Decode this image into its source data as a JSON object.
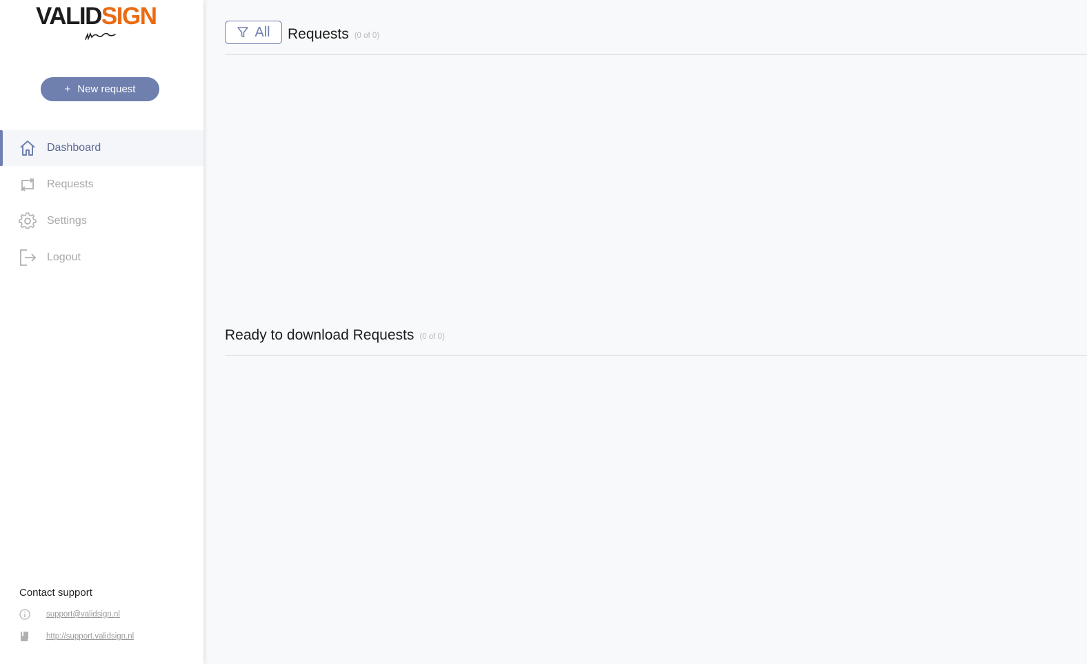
{
  "brand": {
    "logo_part1": "VALID",
    "logo_part2": "SIGN",
    "accent_color": "#6f7fae",
    "logo_orange": "#ea6a12"
  },
  "sidebar": {
    "new_request": {
      "plus": "+",
      "label": "New request"
    },
    "items": [
      {
        "label": "Dashboard",
        "icon": "home-icon",
        "active": true
      },
      {
        "label": "Requests",
        "icon": "swap-arrows-icon",
        "active": false
      },
      {
        "label": "Settings",
        "icon": "gear-icon",
        "active": false
      },
      {
        "label": "Logout",
        "icon": "logout-icon",
        "active": false
      }
    ],
    "support": {
      "title": "Contact support",
      "email": "support@validsign.nl",
      "url": "http://support.validsign.nl"
    }
  },
  "main": {
    "requests_section": {
      "filter_label": "All",
      "title": "Requests",
      "count": "(0 of 0)"
    },
    "ready_section": {
      "title": "Ready to download Requests",
      "count": "(0 of 0)"
    }
  }
}
